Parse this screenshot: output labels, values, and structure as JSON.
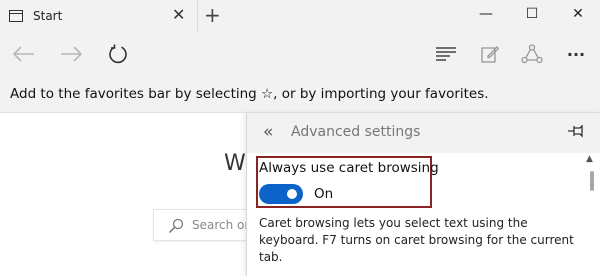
{
  "tab": {
    "title": "Start",
    "close_glyph": "✕",
    "new_tab_glyph": "+"
  },
  "window_controls": {
    "minimize": "—",
    "maximize": "☐",
    "close": "✕"
  },
  "navbar": {
    "icons": [
      "back-icon",
      "forward-icon",
      "refresh-icon",
      "hub-icon",
      "web-note-icon",
      "share-icon",
      "more-icon"
    ],
    "more_glyph": "···"
  },
  "favorites_bar": {
    "text": "Add to the favorites bar by selecting ☆, or by importing your favorites."
  },
  "page": {
    "heading_partial": "W",
    "search_placeholder": "Search or"
  },
  "panel": {
    "back_glyph": "«",
    "title": "Advanced settings",
    "setting": {
      "label": "Always use caret browsing",
      "state": "On",
      "enabled": true,
      "description": "Caret browsing lets you select text using the keyboard. F7 turns on caret browsing for the current tab."
    },
    "accent_color": "#0c64c8",
    "highlight_color": "#8b2323"
  }
}
